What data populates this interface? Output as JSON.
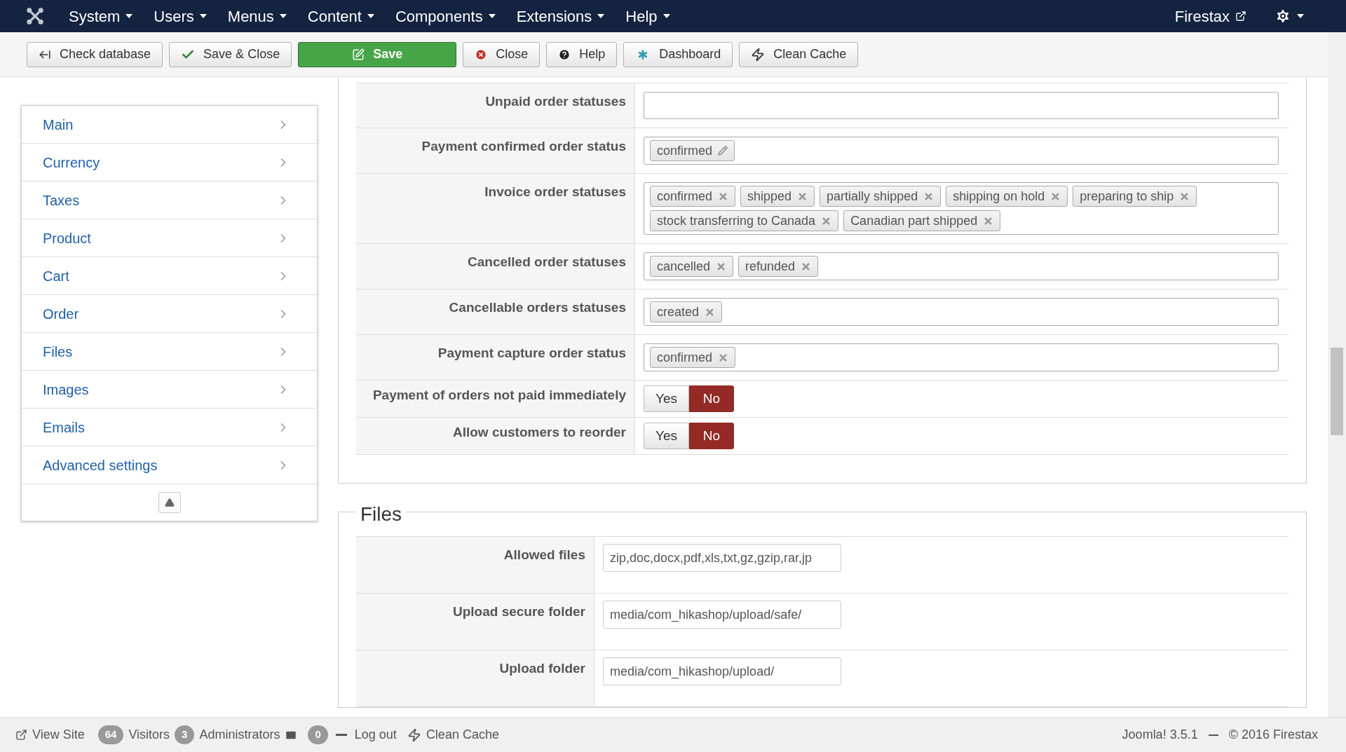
{
  "nav": {
    "menus": [
      "System",
      "Users",
      "Menus",
      "Content",
      "Components",
      "Extensions",
      "Help"
    ],
    "user": "Firestax"
  },
  "toolbar": [
    {
      "label": "Check database",
      "kind": "check"
    },
    {
      "label": "Save & Close",
      "kind": "save-close"
    },
    {
      "label": "Save",
      "kind": "save"
    },
    {
      "label": "Close",
      "kind": "close"
    },
    {
      "label": "Help",
      "kind": "help"
    },
    {
      "label": "Dashboard",
      "kind": "dashboard"
    },
    {
      "label": "Clean Cache",
      "kind": "cache"
    }
  ],
  "sidebar": {
    "items": [
      "Main",
      "Currency",
      "Taxes",
      "Product",
      "Cart",
      "Order",
      "Files",
      "Images",
      "Emails",
      "Advanced settings"
    ]
  },
  "order_fields": [
    {
      "label": "Unpaid order statuses",
      "kind": "tags"
    },
    {
      "label": "Payment confirmed order status",
      "kind": "tags",
      "tags": [
        {
          "text": "confirmed",
          "kind": "edit"
        }
      ]
    },
    {
      "label": "Invoice order statuses",
      "kind": "tags",
      "tags": [
        {
          "text": "confirmed",
          "kind": "remove"
        },
        {
          "text": "shipped",
          "kind": "remove"
        },
        {
          "text": "partially shipped",
          "kind": "remove"
        },
        {
          "text": "shipping on hold",
          "kind": "remove"
        },
        {
          "text": "preparing to ship",
          "kind": "remove"
        },
        {
          "text": "stock transferring to Canada",
          "kind": "remove"
        },
        {
          "text": "Canadian part shipped",
          "kind": "remove"
        }
      ]
    },
    {
      "label": "Cancelled order statuses",
      "kind": "tags",
      "tags": [
        {
          "text": "cancelled",
          "kind": "remove"
        },
        {
          "text": "refunded",
          "kind": "remove"
        }
      ]
    },
    {
      "label": "Cancellable orders statuses",
      "kind": "tags",
      "tags": [
        {
          "text": "created",
          "kind": "remove"
        }
      ]
    },
    {
      "label": "Payment capture order status",
      "kind": "tags",
      "tags": [
        {
          "text": "confirmed",
          "kind": "remove"
        }
      ]
    },
    {
      "label": "Payment of orders not paid immediately",
      "kind": "toggle",
      "options": [
        {
          "label": "Yes",
          "selected": false
        },
        {
          "label": "No",
          "selected": true
        }
      ]
    },
    {
      "label": "Allow customers to reorder",
      "kind": "toggle",
      "options": [
        {
          "label": "Yes",
          "selected": false
        },
        {
          "label": "No",
          "selected": true
        }
      ]
    }
  ],
  "files": {
    "legend": "Files",
    "fields": [
      {
        "label": "Allowed files",
        "value": "zip,doc,docx,pdf,xls,txt,gz,gzip,rar,jp"
      },
      {
        "label": "Upload secure folder",
        "value": "media/com_hikashop/upload/safe/"
      },
      {
        "label": "Upload folder",
        "value": "media/com_hikashop/upload/"
      }
    ]
  },
  "status_bar": {
    "view_site": "View Site",
    "visitors_count": "64",
    "visitors": "Visitors",
    "admins_count": "3",
    "admins": "Administrators",
    "messages_count": "0",
    "logout": "Log out",
    "clean_cache": "Clean Cache",
    "version": "Joomla! 3.5.1",
    "copyright": "© 2016 Firestax"
  }
}
